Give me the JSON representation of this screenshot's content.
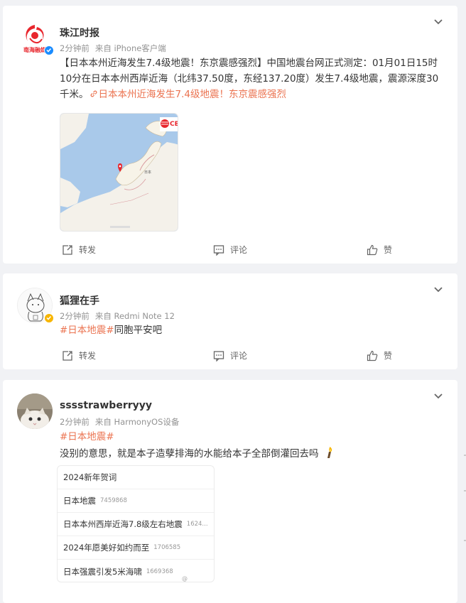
{
  "posts": [
    {
      "author": "珠江时报",
      "time": "2分钟前",
      "source": "来自 iPhone客户端",
      "text": "【日本本州近海发生7.4级地震！东京震感强烈】中国地震台网正式测定：01月01日15时10分在日本本州西岸近海（北纬37.50度，东经137.20度）发生7.4级地震，震源深度30千米。",
      "link": "日本本州近海发生7.4级地震！东京震感强烈",
      "avatar_text": "南海融媒",
      "map_logo": "CE",
      "map_country": "日本",
      "actions": {
        "repost": "转发",
        "comment": "评论",
        "like": "赞"
      }
    },
    {
      "author": "狐狸在手",
      "time": "2分钟前",
      "source": "来自 Redmi Note 12",
      "hashtag": "#日本地震#",
      "text": "同胞平安吧",
      "actions": {
        "repost": "转发",
        "comment": "评论",
        "like": "赞"
      }
    },
    {
      "author": "sssstrawberryyy",
      "time": "2分钟前",
      "source": "来自 HarmonyOS设备",
      "hashtag": "#日本地震#",
      "text": "没别的意思，就是本子造孽排海的水能给本子全部倒灌回去吗",
      "hot_list": [
        {
          "title": "2024新年贺词",
          "count": ""
        },
        {
          "title": "日本地震",
          "count": "7459868"
        },
        {
          "title": "日本本州西岸近海7.8级左右地震",
          "count": "1624..."
        },
        {
          "title": "2024年愿美好如约而至",
          "count": "1706585"
        },
        {
          "title": "日本强震引发5米海啸",
          "count": "1669368"
        }
      ],
      "watermark": "@"
    }
  ],
  "colors": {
    "accent": "#eb7350",
    "verified_blue": "#1a8cff",
    "verified_gold": "#f7b500"
  }
}
